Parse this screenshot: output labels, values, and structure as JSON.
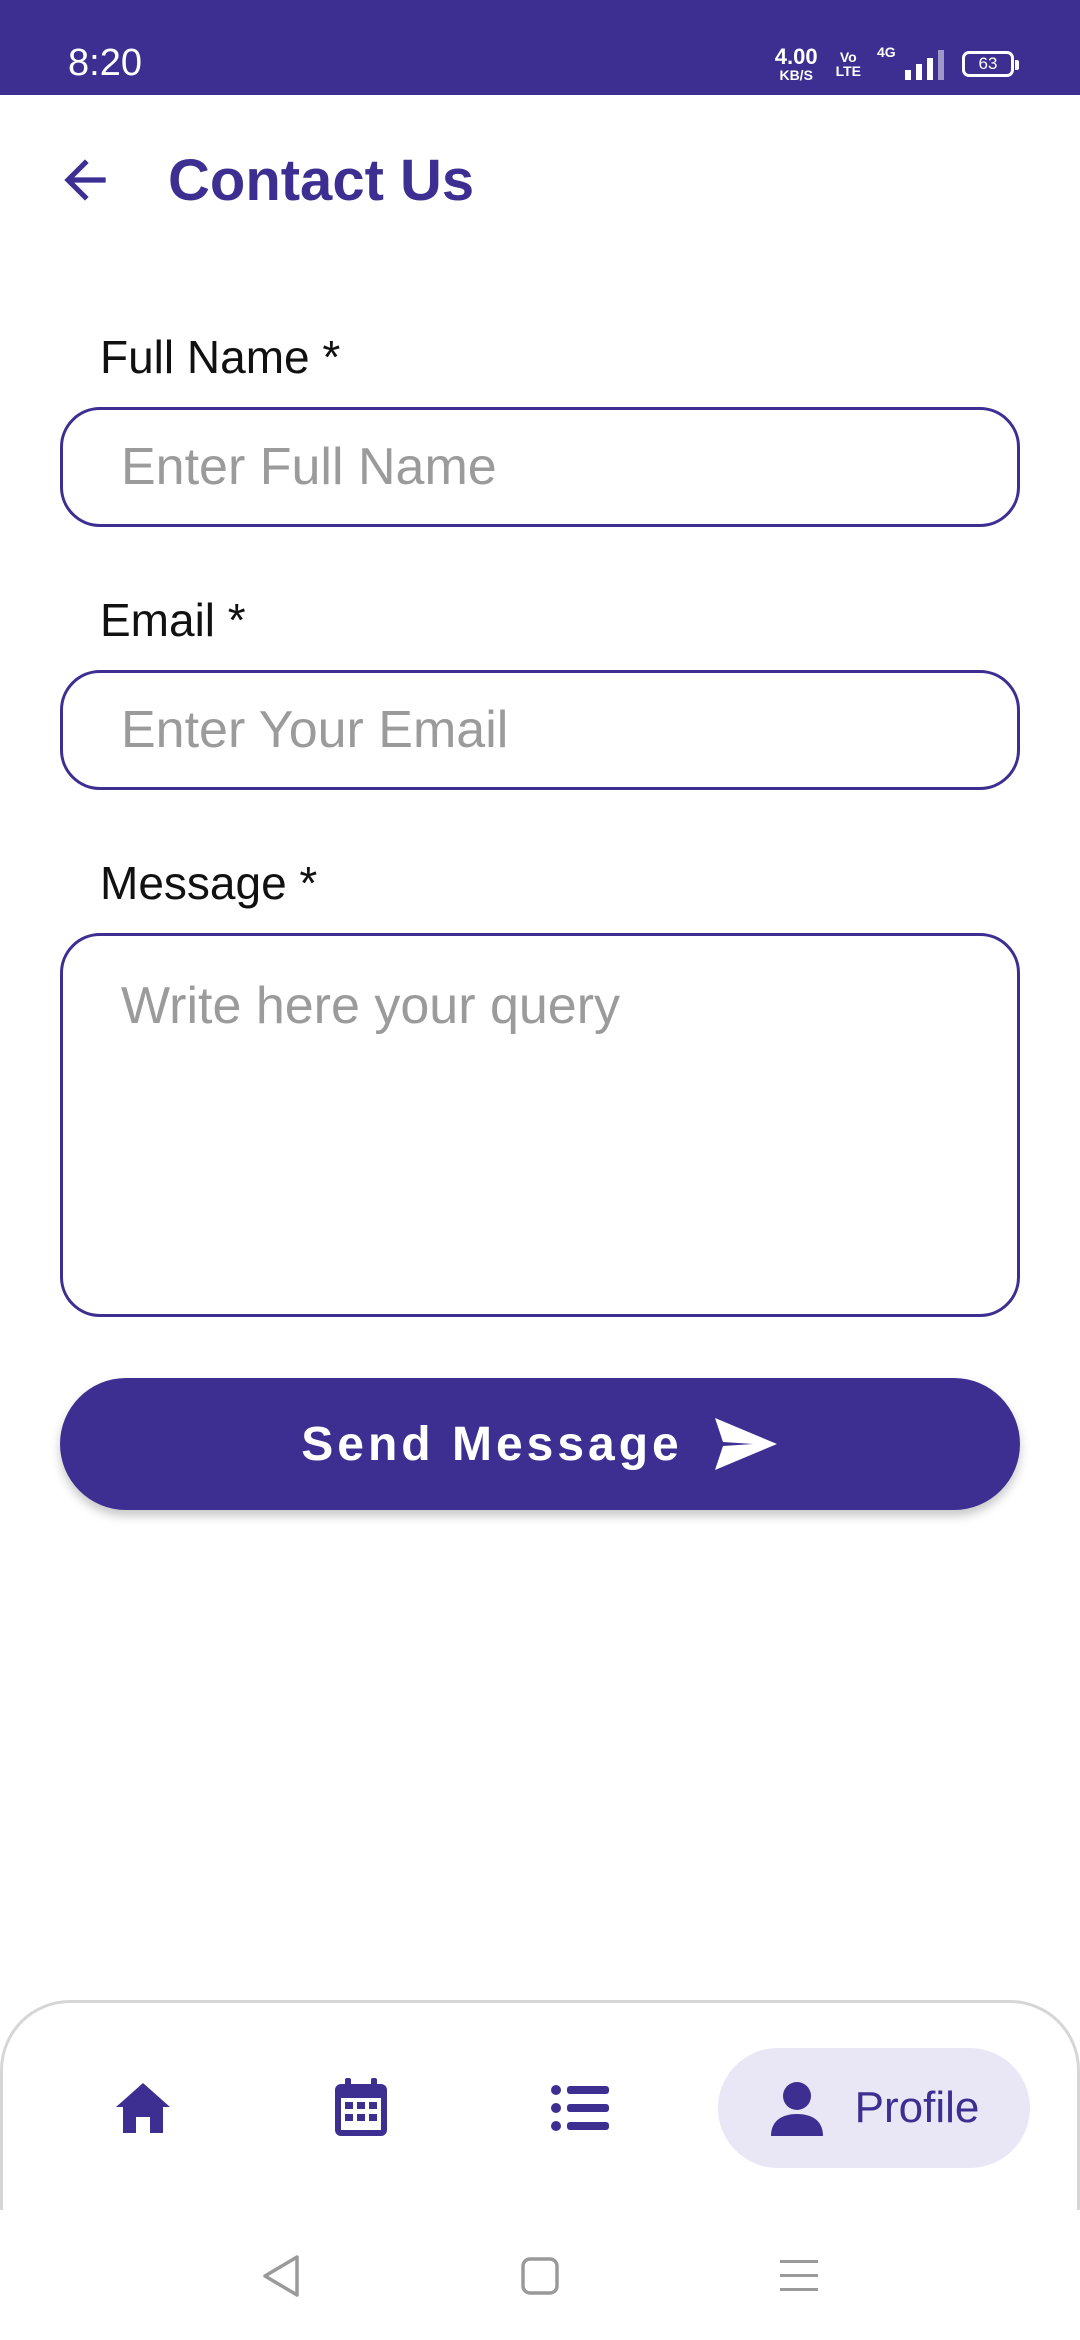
{
  "status_bar": {
    "time": "8:20",
    "net_speed_value": "4.00",
    "net_speed_unit": "KB/S",
    "volte_top": "Vo",
    "volte_bottom": "LTE",
    "network": "4G",
    "battery": "63"
  },
  "header": {
    "title": "Contact Us",
    "back_icon": "arrow-left-icon"
  },
  "form": {
    "full_name": {
      "label": "Full Name *",
      "placeholder": "Enter Full Name",
      "value": ""
    },
    "email": {
      "label": "Email *",
      "placeholder": "Enter Your Email",
      "value": ""
    },
    "message": {
      "label": "Message *",
      "placeholder": "Write here your query",
      "value": ""
    },
    "submit": {
      "label": "Send Message",
      "icon": "send-icon"
    }
  },
  "bottom_nav": {
    "items": [
      {
        "name": "home",
        "icon": "home-icon",
        "label": ""
      },
      {
        "name": "calendar",
        "icon": "calendar-icon",
        "label": ""
      },
      {
        "name": "list",
        "icon": "list-icon",
        "label": ""
      },
      {
        "name": "profile",
        "icon": "person-icon",
        "label": "Profile",
        "active": true
      }
    ]
  },
  "colors": {
    "primary": "#3d2f91",
    "active_nav_bg": "#e9e6f5",
    "placeholder": "#9b9b9b"
  }
}
